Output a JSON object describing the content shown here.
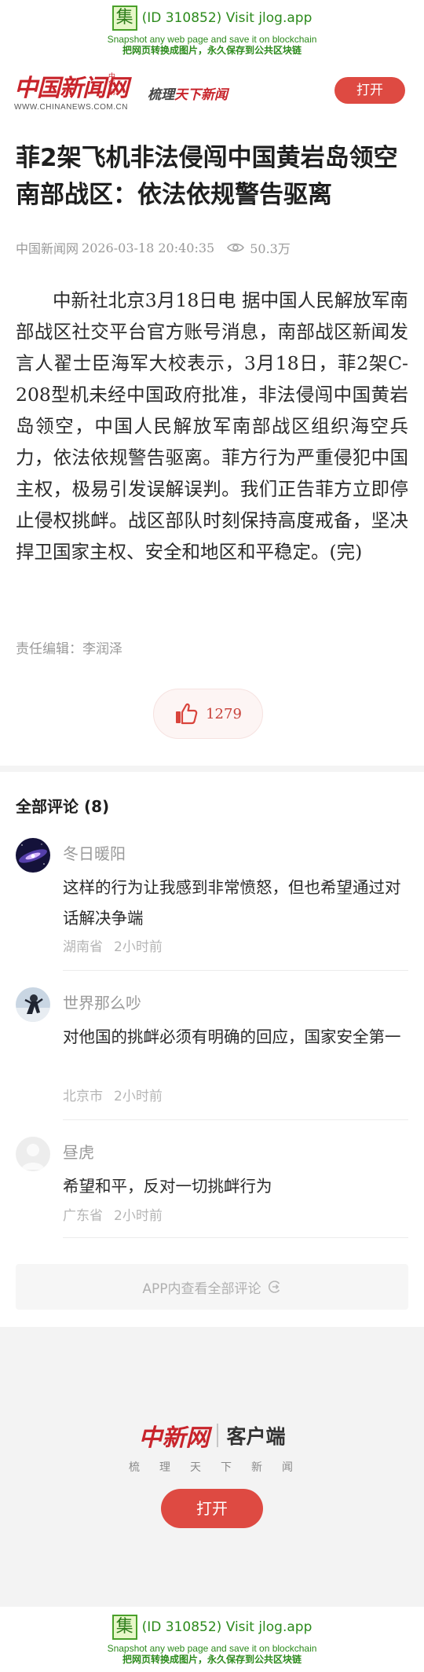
{
  "jlog": {
    "logo_char": "集",
    "id_line": "(ID 310852) Visit jlog.app",
    "en_line": "Snapshot any web page and save it on blockchain",
    "cn_line": "把网页转换成图片，永久保存到公共区块链"
  },
  "header": {
    "logo_text": "中国新闻网",
    "logo_small": "中新网",
    "logo_url": "WWW.CHINANEWS.COM.CN",
    "slogan_a": "梳理",
    "slogan_b": "天下新闻",
    "open_label": "打开"
  },
  "article": {
    "title": "菲2架飞机非法侵闯中国黄岩岛领空 南部战区：依法依规警告驱离",
    "source": "中国新闻网",
    "datetime": "2026-03-18 20:40:35",
    "views": "50.3万",
    "body": "中新社北京3月18日电 据中国人民解放军南部战区社交平台官方账号消息，南部战区新闻发言人翟士臣海军大校表示，3月18日，菲2架C-208型机未经中国政府批准，非法侵闯中国黄岩岛领空，中国人民解放军南部战区组织海空兵力，依法依规警告驱离。菲方行为严重侵犯中国主权，极易引发误解误判。我们正告菲方立即停止侵权挑衅。战区部队时刻保持高度戒备，坚决捍卫国家主权、安全和地区和平稳定。(完)",
    "editor": "责任编辑：李润泽",
    "likes": "1279"
  },
  "comments": {
    "header": "全部评论 (8)",
    "items": [
      {
        "name": "冬日暖阳",
        "text": "这样的行为让我感到非常愤怒，但也希望通过对话解决争端",
        "location": "湖南省",
        "time": "2小时前"
      },
      {
        "name": "世界那么吵",
        "text": "对他国的挑衅必须有明确的回应，国家安全第一",
        "location": "北京市",
        "time": "2小时前"
      },
      {
        "name": "昼虎",
        "text": "希望和平，反对一切挑衅行为",
        "location": "广东省",
        "time": "2小时前"
      }
    ],
    "view_all": "APP内查看全部评论"
  },
  "promo": {
    "logo_text": "中新网",
    "client_label": "客户端",
    "tagline": "梳理天下新闻",
    "open_label": "打开"
  },
  "colors": {
    "accent": "#de4a42",
    "brand_red": "#c8242b",
    "jlog_green": "#2c8a1c"
  }
}
